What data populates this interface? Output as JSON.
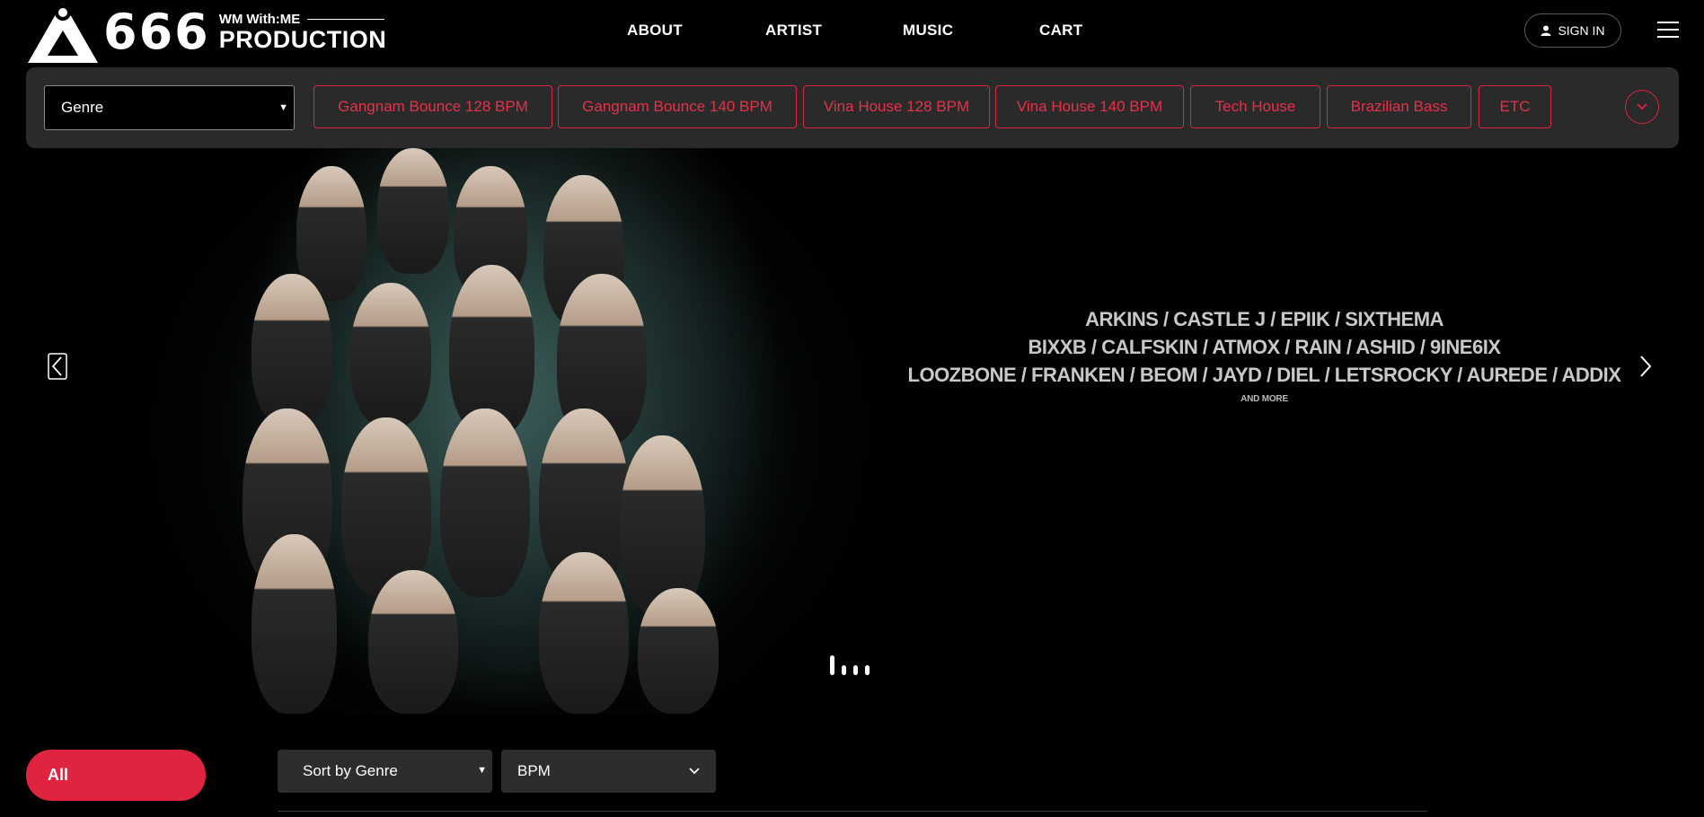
{
  "header": {
    "logo_number": "666",
    "logo_wm": "With:ME",
    "logo_wm_badge": "WM",
    "logo_production": "PRODUCTION",
    "nav": [
      "ABOUT",
      "ARTIST",
      "MUSIC",
      "CART"
    ],
    "sign_in": "SIGN IN"
  },
  "genre_bar": {
    "select_value": "Genre",
    "chips": [
      "Gangnam Bounce 128 BPM",
      "Gangnam Bounce 140 BPM",
      "Vina House 128 BPM",
      "Vina House 140 BPM",
      "Tech House",
      "Brazilian Bass",
      "ETC"
    ]
  },
  "hero": {
    "artist_lines": [
      "ARKINS / CASTLE J / EPIIK / SIXTHEMA",
      "BIXXB / CALFSKIN / ATMOX / RAIN / ASHID / 9INE6IX",
      "LOOZBONE / FRANKEN / BEOM / JAYD / DIEL / LETSROCKY / AUREDE / ADDIX"
    ],
    "and_more": "AND MORE",
    "slide_count": 4,
    "active_slide": 1
  },
  "filters": {
    "all_label": "All",
    "sort_label": "Sort by Genre",
    "bpm_label": "BPM"
  },
  "colors": {
    "accent": "#e0243f",
    "background": "#000000",
    "panel": "#2a2a2a"
  }
}
